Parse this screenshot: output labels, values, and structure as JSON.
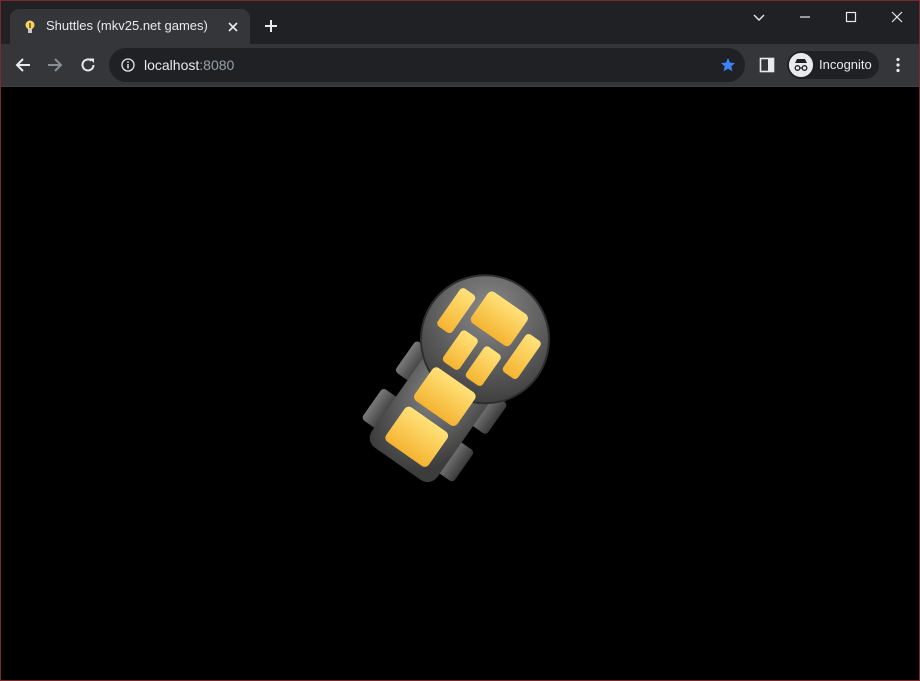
{
  "browser": {
    "tab": {
      "title": "Shuttles (mkv25.net games)"
    },
    "address_bar": {
      "host": "localhost",
      "port": ":8080"
    },
    "profile": {
      "label": "Incognito"
    }
  },
  "colors": {
    "titlebar": "#202124",
    "toolbar": "#35363a",
    "bookmark_star": "#3b82f6",
    "game_background": "#000000",
    "shuttle_window": "#ffc94a",
    "shuttle_hull": "#5a5a5a"
  },
  "game": {
    "sprite": "shuttle",
    "heading_degrees": 35
  }
}
